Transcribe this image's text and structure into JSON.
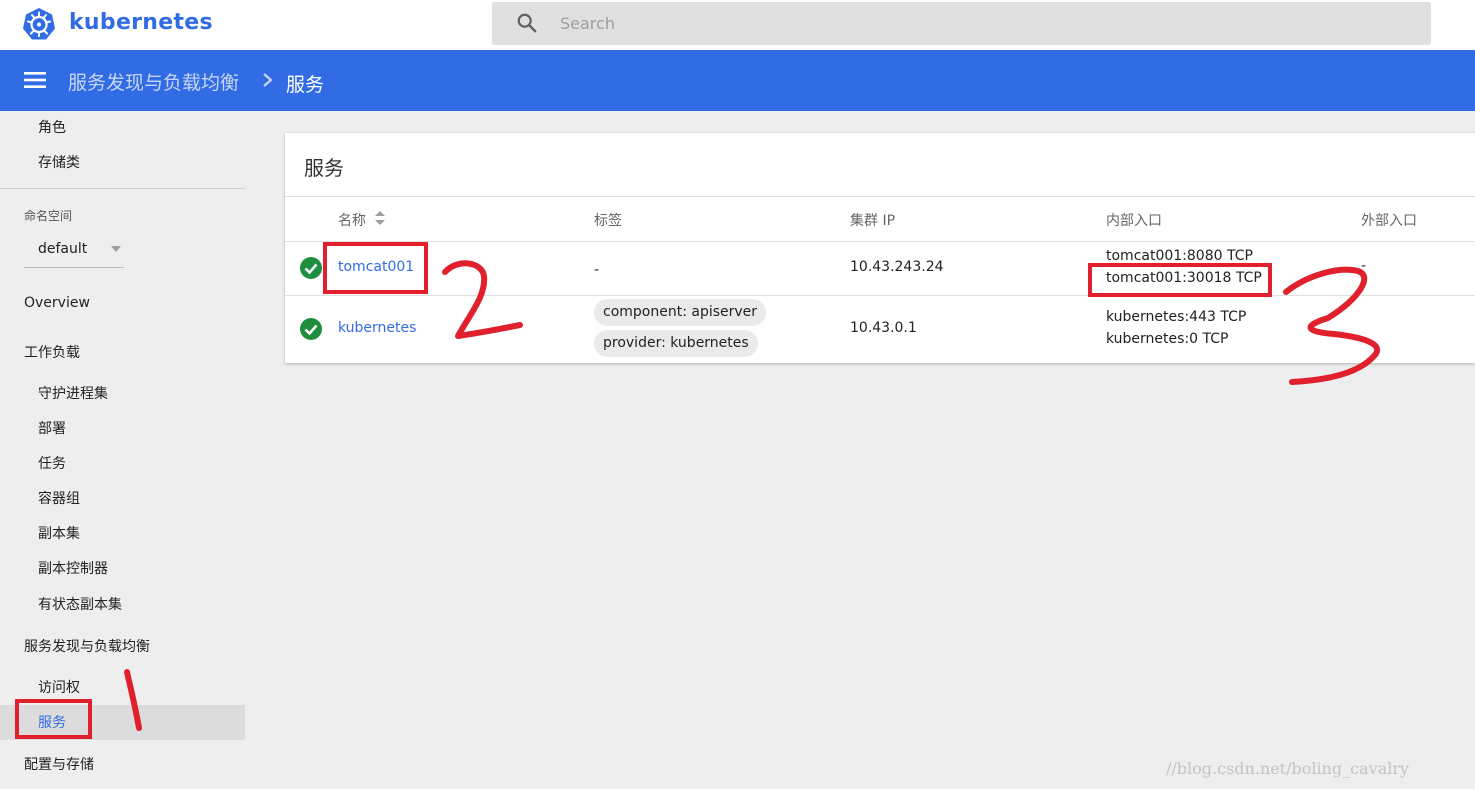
{
  "app": {
    "brand": "kubernetes",
    "search_placeholder": "Search"
  },
  "header": {
    "breadcrumb_parent": "服务发现与负载均衡",
    "breadcrumb_current": "服务"
  },
  "sidebar": {
    "top_items": [
      "角色",
      "存储类"
    ],
    "namespace_label": "命名空间",
    "namespace_value": "default",
    "overview": "Overview",
    "workloads": {
      "label": "工作负载",
      "items": [
        "守护进程集",
        "部署",
        "任务",
        "容器组",
        "副本集",
        "副本控制器",
        "有状态副本集"
      ]
    },
    "discovery": {
      "label": "服务发现与负载均衡",
      "items": [
        "访问权",
        "服务"
      ]
    },
    "config": "配置与存储"
  },
  "services_card": {
    "title": "服务",
    "columns": [
      "名称",
      "标签",
      "集群 IP",
      "内部入口",
      "外部入口"
    ],
    "rows": [
      {
        "name": "tomcat001",
        "labels": "-",
        "cluster_ip": "10.43.243.24",
        "internal_endpoints": [
          "tomcat001:8080 TCP",
          "tomcat001:30018 TCP"
        ],
        "external_endpoints": "-"
      },
      {
        "name": "kubernetes",
        "labels": [
          "component: apiserver",
          "provider: kubernetes"
        ],
        "cluster_ip": "10.43.0.1",
        "internal_endpoints": [
          "kubernetes:443 TCP",
          "kubernetes:0 TCP"
        ],
        "external_endpoints": "-"
      }
    ]
  },
  "colors": {
    "accent": "#326ce5",
    "success": "#1e8e3e",
    "annotation": "#e0202c"
  },
  "watermark": "//blog.csdn.net/boling_cavalry"
}
